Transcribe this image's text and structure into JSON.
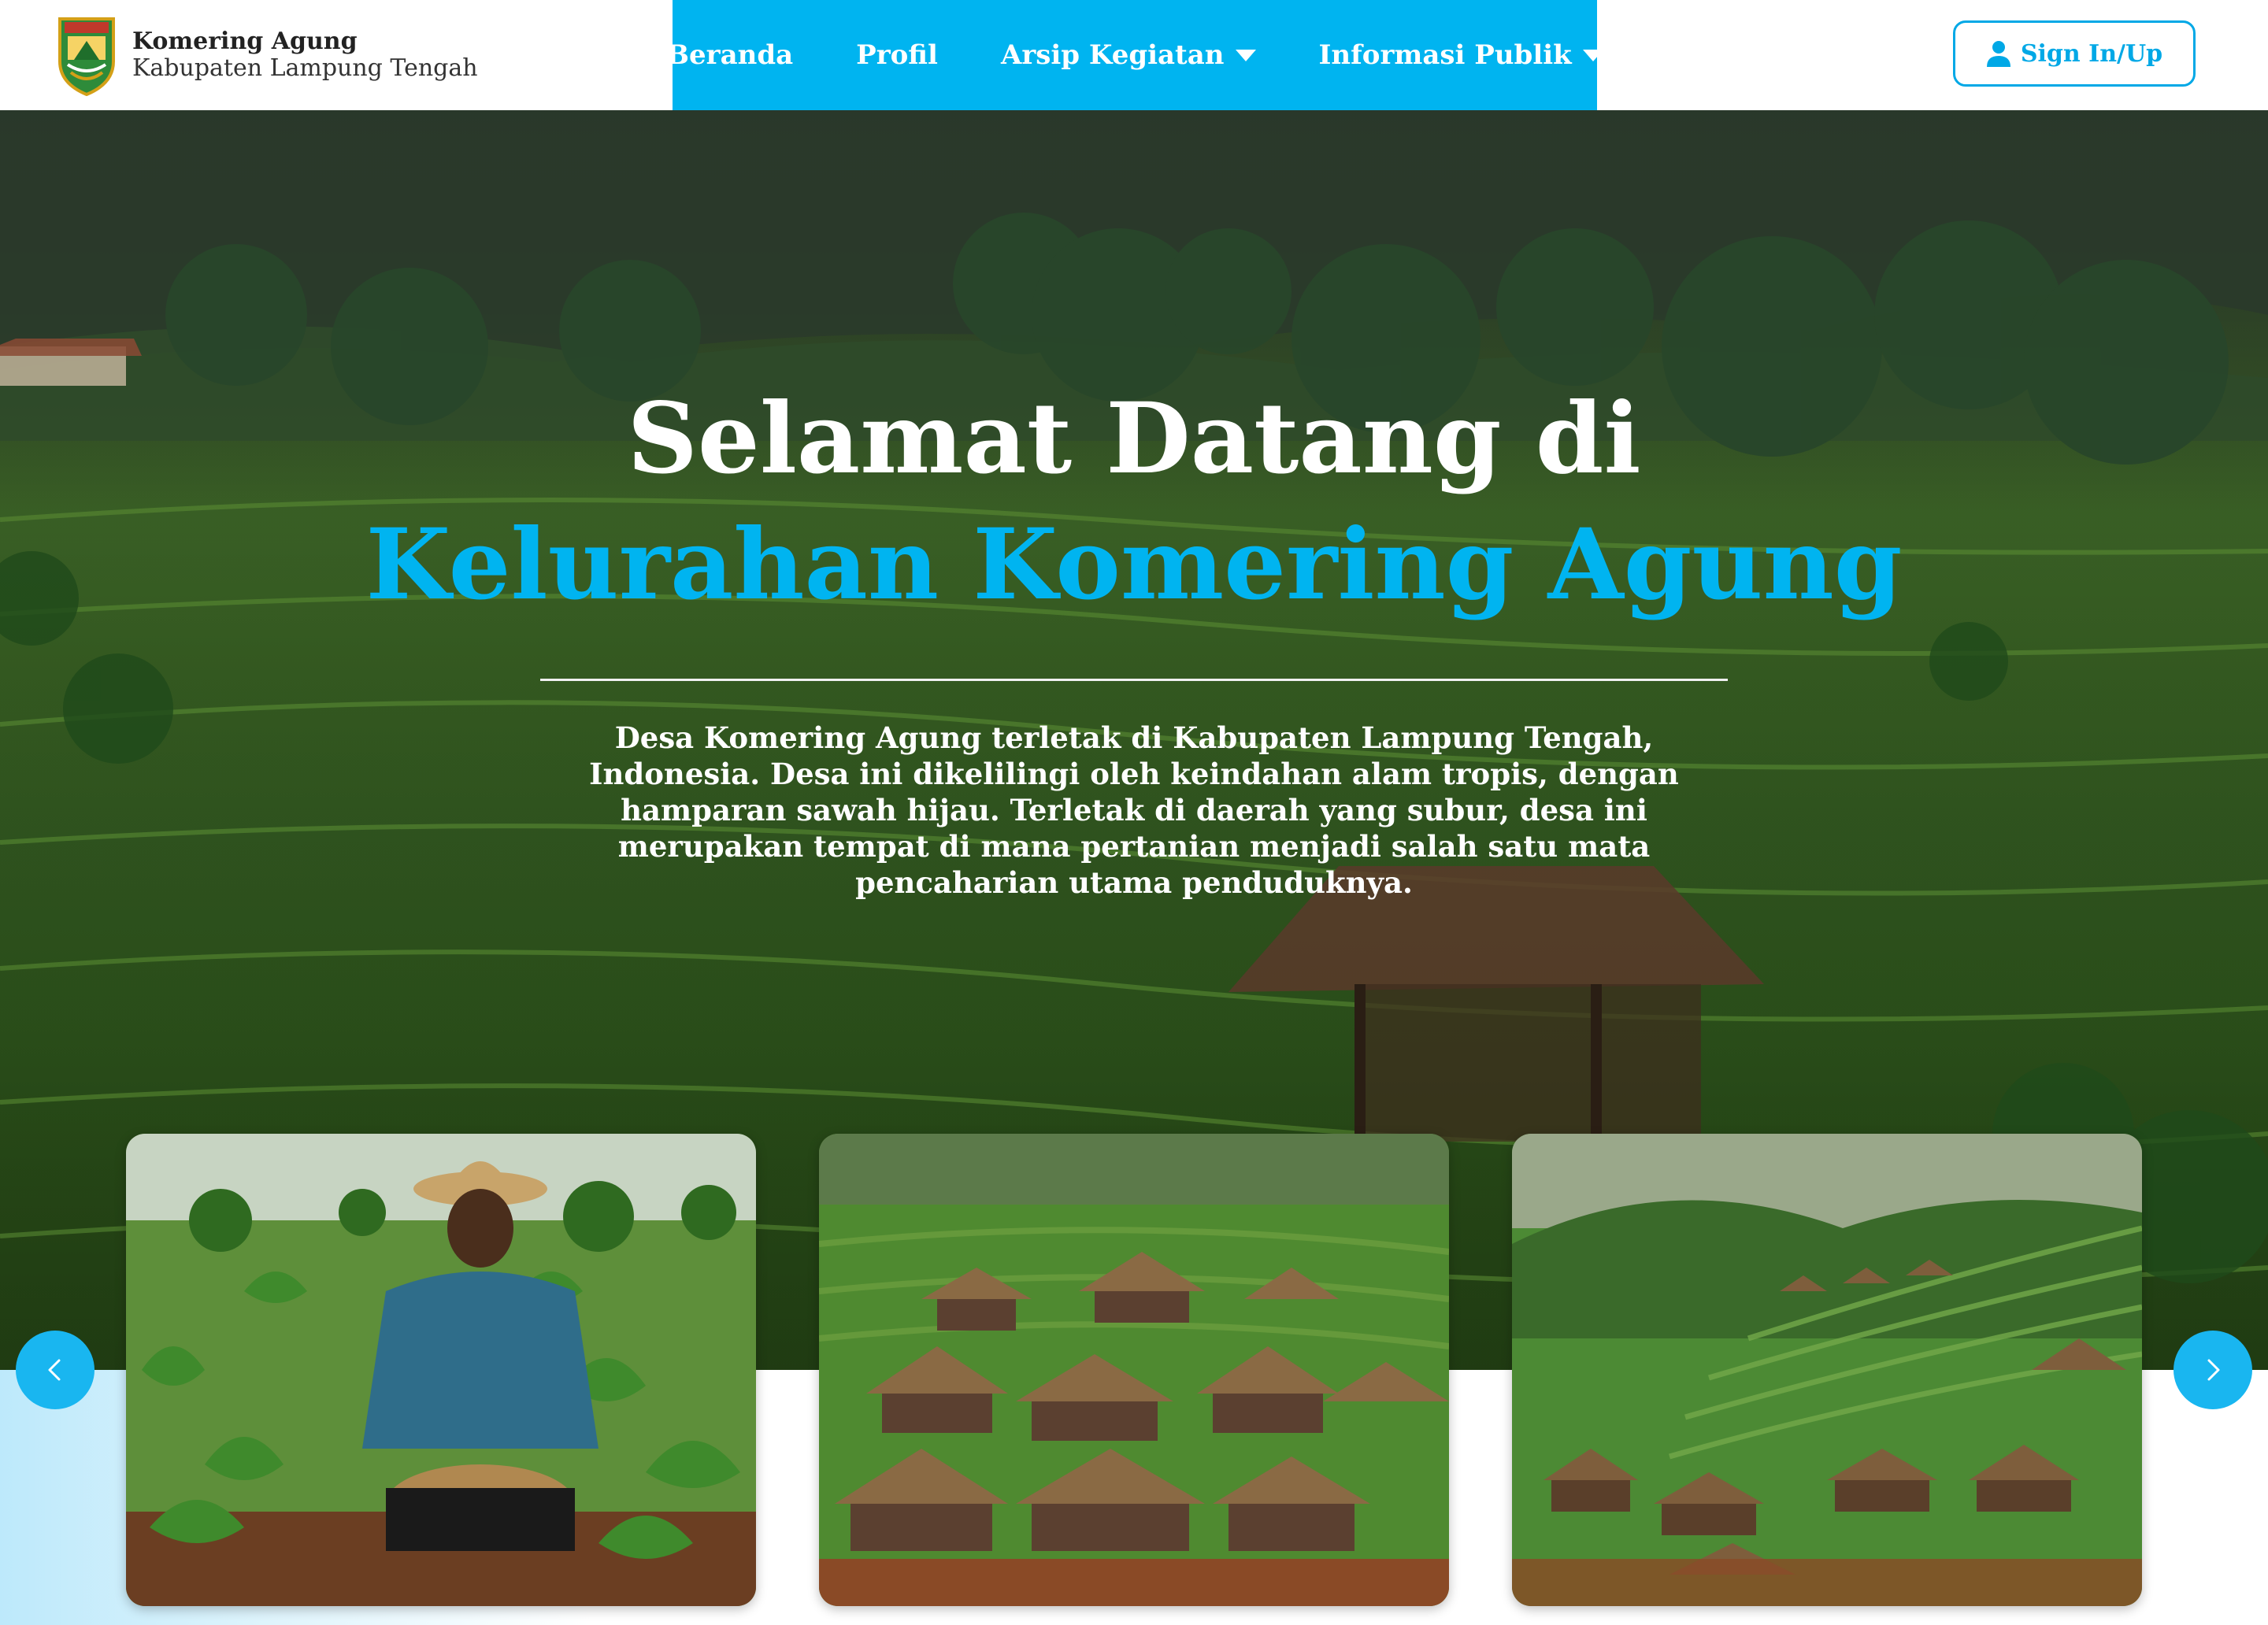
{
  "header": {
    "brand_name": "Komering Agung",
    "brand_sub": "Kabupaten Lampung Tengah",
    "logo_icon": "shield-crest-icon",
    "nav": [
      {
        "label": "Beranda",
        "has_dropdown": false
      },
      {
        "label": "Profil",
        "has_dropdown": false
      },
      {
        "label": "Arsip Kegiatan",
        "has_dropdown": true
      },
      {
        "label": "Informasi Publik",
        "has_dropdown": true
      }
    ],
    "signin_label": "Sign In/Up",
    "signin_icon": "user-icon"
  },
  "hero": {
    "title_line1": "Selamat Datang di",
    "title_line2": "Kelurahan Komering Agung",
    "description": "Desa Komering Agung terletak di Kabupaten Lampung Tengah, Indonesia. Desa ini dikelilingi oleh keindahan alam tropis, dengan hamparan sawah hijau. Terletak di daerah yang subur, desa ini merupakan tempat di mana pertanian menjadi salah satu mata pencaharian utama penduduknya."
  },
  "carousel": {
    "prev_icon": "chevron-left-icon",
    "next_icon": "chevron-right-icon",
    "slides": [
      {
        "subject": "farmer-in-field-photo"
      },
      {
        "subject": "thatched-village-photo"
      },
      {
        "subject": "hillside-village-photo"
      }
    ]
  },
  "colors": {
    "accent": "#00b4f0",
    "nav_bg": "#00b4f0",
    "text_dark": "#222222",
    "band_light": "#bde9fb"
  }
}
